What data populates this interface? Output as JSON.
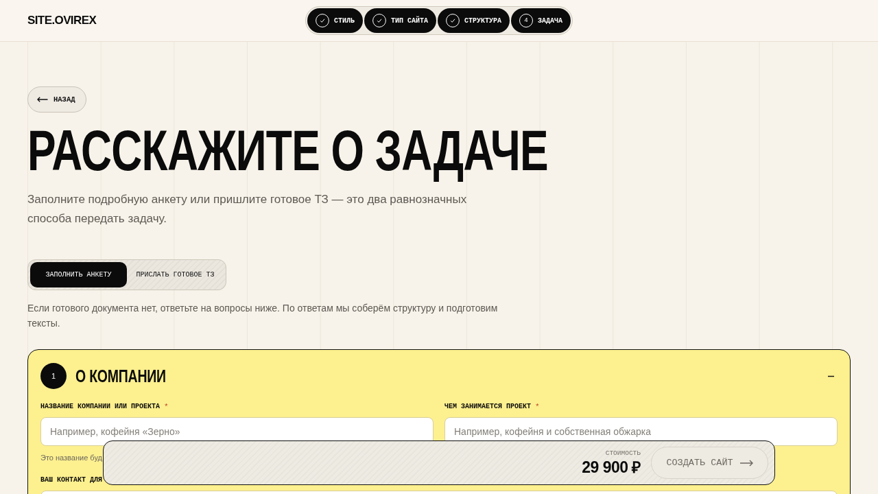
{
  "header": {
    "logo": "SITE.OVIREX",
    "steps": [
      {
        "label": "СТИЛЬ",
        "done": true
      },
      {
        "label": "ТИП САЙТА",
        "done": true
      },
      {
        "label": "СТРУКТУРА",
        "done": true
      },
      {
        "label": "ЗАДАЧА",
        "number": "4",
        "done": false
      }
    ]
  },
  "back_button": {
    "label": "НАЗАД"
  },
  "title": "РАССКАЖИТЕ О ЗАДАЧЕ",
  "subtitle": "Заполните подробную анкету или пришлите готовое ТЗ — это два равнозначных способа передать задачу.",
  "mode_tabs": [
    {
      "label": "ЗАПОЛНИТЬ АНКЕТУ",
      "selected": true
    },
    {
      "label": "ПРИСЛАТЬ ГОТОВОЕ ТЗ",
      "selected": false
    }
  ],
  "note": "Если готового документа нет, ответьте на вопросы ниже. По ответам мы соберём структуру и подготовим тексты.",
  "section": {
    "number": "1",
    "title": "О КОМПАНИИ",
    "expanded": true,
    "fields": [
      {
        "kind": "half",
        "label": "НАЗВАНИЕ КОМПАНИИ ИЛИ ПРОЕКТА",
        "required_mark": "*",
        "placeholder": "Например, кофейня «Зерно»",
        "hint": "Это название буд"
      },
      {
        "kind": "half",
        "label": "ЧЕМ ЗАНИМАЕТСЯ ПРОЕКТ",
        "required_mark": "*",
        "placeholder": "Например, кофейня и собственная обжарка"
      },
      {
        "kind": "full",
        "label": "ВАШ КОНТАКТ ДЛЯ"
      }
    ]
  },
  "price_bar": {
    "label": "СТОИМОСТЬ",
    "price": "29 900 ₽",
    "button": {
      "label": "СОЗДАТЬ САЙТ",
      "disabled": true
    }
  }
}
